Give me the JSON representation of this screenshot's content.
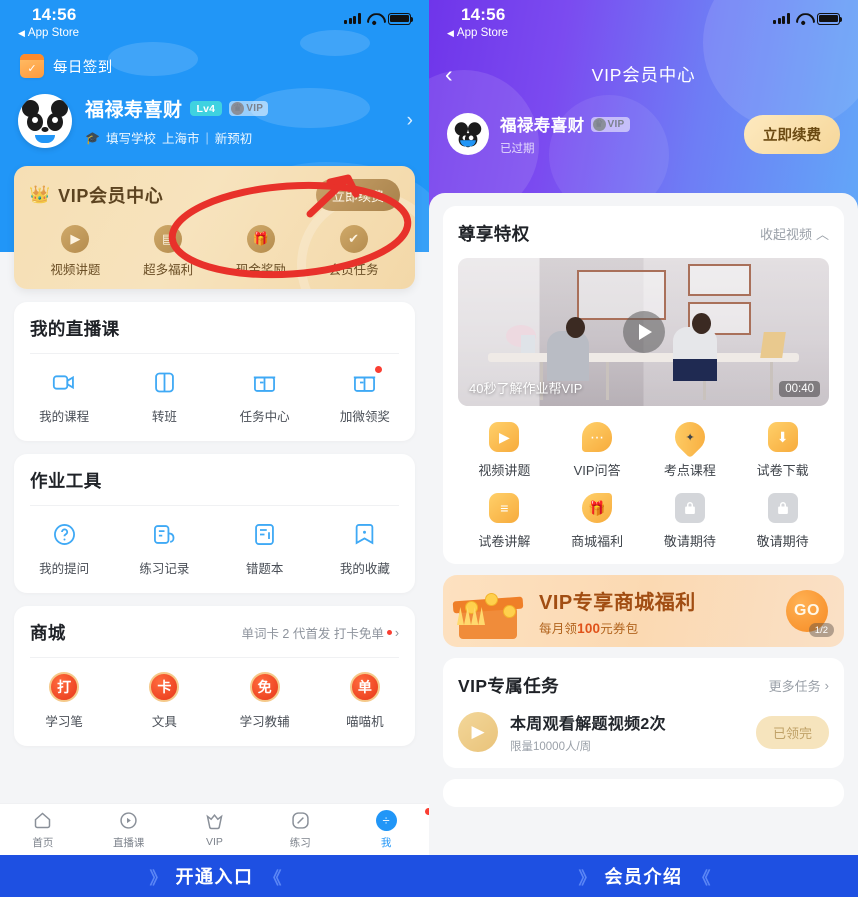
{
  "status_bar": {
    "time": "14:56",
    "back_app": "App Store"
  },
  "left": {
    "signin_label": "每日签到",
    "profile": {
      "name": "福禄寿喜财",
      "level_badge": "Lv4",
      "vip_badge": "VIP",
      "school_placeholder": "填写学校",
      "city": "上海市",
      "grade": "新预初",
      "arrow": "›"
    },
    "vip_card": {
      "title": "VIP会员中心",
      "renew_label": "立即续费",
      "items": [
        {
          "label": "视频讲题",
          "icon": "video-icon"
        },
        {
          "label": "超多福利",
          "icon": "gift-box-icon"
        },
        {
          "label": "现金奖励",
          "icon": "cash-icon"
        },
        {
          "label": "会员任务",
          "icon": "task-icon"
        }
      ]
    },
    "sections": [
      {
        "title": "我的直播课",
        "link": "",
        "items": [
          {
            "label": "我的课程",
            "icon": "course-icon",
            "badge": false
          },
          {
            "label": "转班",
            "icon": "transfer-icon",
            "badge": false
          },
          {
            "label": "任务中心",
            "icon": "task-center-icon",
            "badge": false
          },
          {
            "label": "加微领奖",
            "icon": "wechat-prize-icon",
            "badge": true
          }
        ]
      },
      {
        "title": "作业工具",
        "link": "",
        "items": [
          {
            "label": "我的提问",
            "icon": "question-icon",
            "badge": false
          },
          {
            "label": "练习记录",
            "icon": "practice-record-icon",
            "badge": false
          },
          {
            "label": "错题本",
            "icon": "wrong-question-icon",
            "badge": false
          },
          {
            "label": "我的收藏",
            "icon": "bookmark-icon",
            "badge": false
          }
        ]
      },
      {
        "title": "商城",
        "link": "单词卡 2 代首发 打卡免单",
        "items": [
          {
            "label": "学习笔",
            "icon": "pen-icon",
            "glyph": "打"
          },
          {
            "label": "文具",
            "icon": "stationery-icon",
            "glyph": "卡"
          },
          {
            "label": "学习教辅",
            "icon": "book-icon",
            "glyph": "免"
          },
          {
            "label": "喵喵机",
            "icon": "printer-icon",
            "glyph": "单"
          }
        ]
      }
    ],
    "tabbar": [
      {
        "label": "首页",
        "icon": "home-icon",
        "active": false,
        "badge": false
      },
      {
        "label": "直播课",
        "icon": "live-class-icon",
        "active": false,
        "badge": false
      },
      {
        "label": "VIP",
        "icon": "vip-crown-icon",
        "active": false,
        "badge": false
      },
      {
        "label": "练习",
        "icon": "practice-icon",
        "active": false,
        "badge": false
      },
      {
        "label": "我",
        "icon": "profile-icon",
        "active": true,
        "badge": true
      }
    ],
    "footer": {
      "label": "开通入口",
      "left_chevron": "》",
      "right_chevron": "《"
    }
  },
  "right": {
    "nav": {
      "back_icon": "chevron-left-icon",
      "title": "VIP会员中心"
    },
    "profile": {
      "name": "福禄寿喜财",
      "vip_badge": "VIP",
      "status": "已过期",
      "renew_label": "立即续费"
    },
    "privileges": {
      "title": "尊享特权",
      "collapse_label": "收起视频",
      "collapse_caret": "︿",
      "video": {
        "caption": "40秒了解作业帮VIP",
        "duration": "00:40"
      },
      "items": [
        {
          "label": "视频讲题",
          "icon": "video-folder-icon",
          "locked": false
        },
        {
          "label": "VIP问答",
          "icon": "chat-bubble-icon",
          "locked": false
        },
        {
          "label": "考点课程",
          "icon": "location-pin-icon",
          "locked": false
        },
        {
          "label": "试卷下载",
          "icon": "download-icon",
          "locked": false
        },
        {
          "label": "试卷讲解",
          "icon": "list-icon",
          "locked": false
        },
        {
          "label": "商城福利",
          "icon": "gift-icon",
          "locked": false
        },
        {
          "label": "敬请期待",
          "icon": "lock-icon",
          "locked": true
        },
        {
          "label": "敬请期待",
          "icon": "lock-icon",
          "locked": true
        }
      ]
    },
    "mall_banner": {
      "title": "VIP专享商城福利",
      "subtitle_pre": "每月领",
      "subtitle_amount": "100",
      "subtitle_post": "元券包",
      "go_label": "GO",
      "page_indicator": "1/2"
    },
    "tasks": {
      "title": "VIP专属任务",
      "more_label": "更多任务",
      "more_caret": "›",
      "list": [
        {
          "title": "本周观看解题视频2次",
          "sub": "限量10000人/周",
          "action": "已领完",
          "icon": "video-play-icon"
        }
      ]
    },
    "footer": {
      "label": "会员介绍",
      "left_chevron": "》",
      "right_chevron": "《"
    }
  },
  "colors": {
    "left_hero": "#2196f7",
    "accent_blue": "#1e50e2",
    "gold": "#c9a26a",
    "annotation_red": "#e8312a"
  }
}
